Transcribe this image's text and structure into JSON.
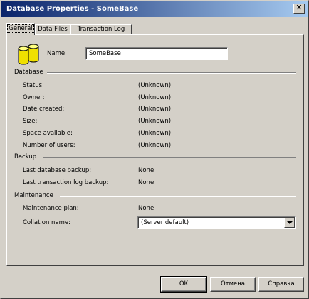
{
  "window": {
    "title": "Database Properties - SomeBase",
    "close_glyph": "✕",
    "colors": {
      "title_start": "#0a246a",
      "title_end": "#a6caf0",
      "face": "#d4d0c8"
    }
  },
  "tabs": [
    {
      "label": "General",
      "active": true
    },
    {
      "label": "Data Files",
      "active": false
    },
    {
      "label": "Transaction Log",
      "active": false
    }
  ],
  "general": {
    "icon": "database-icon",
    "name_label": "Name:",
    "name_value": "SomeBase"
  },
  "database": {
    "section": "Database",
    "rows": [
      {
        "label": "Status:",
        "value": "(Unknown)"
      },
      {
        "label": "Owner:",
        "value": "(Unknown)"
      },
      {
        "label": "Date created:",
        "value": "(Unknown)"
      },
      {
        "label": "Size:",
        "value": "(Unknown)"
      },
      {
        "label": "Space available:",
        "value": "(Unknown)"
      },
      {
        "label": "Number of users:",
        "value": "(Unknown)"
      }
    ]
  },
  "backup": {
    "section": "Backup",
    "rows": [
      {
        "label": "Last database backup:",
        "value": "None"
      },
      {
        "label": "Last transaction log backup:",
        "value": "None"
      }
    ]
  },
  "maintenance": {
    "section": "Maintenance",
    "plan_label": "Maintenance plan:",
    "plan_value": "None",
    "collation_label": "Collation name:",
    "collation_value": "(Server default)"
  },
  "buttons": {
    "ok": "OK",
    "cancel": "Отмена",
    "help": "Справка"
  }
}
